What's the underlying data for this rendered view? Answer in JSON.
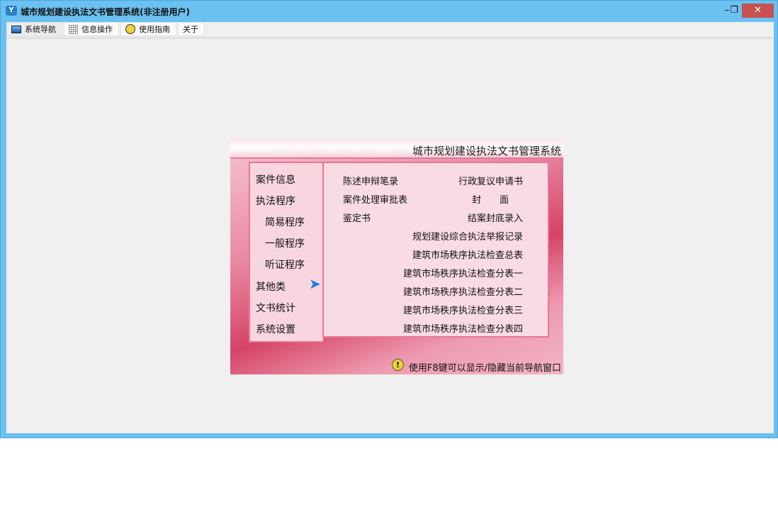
{
  "window": {
    "title": "城市规划建设执法文书管理系统(非注册用户)",
    "minimize": "–",
    "restore": "❐",
    "close": "✕"
  },
  "tabs": [
    {
      "label": "系统导航",
      "icon": "monitor-icon"
    },
    {
      "label": "信息操作",
      "icon": "grid-icon"
    },
    {
      "label": "使用指南",
      "icon": "clock-icon"
    },
    {
      "label": "关于"
    }
  ],
  "panel": {
    "title": "城市规划建设执法文书管理系统",
    "left_menu": [
      "案件信息",
      "执法程序",
      "简易程序",
      "一般程序",
      "听证程序",
      "其他类",
      "文书统计",
      "系统设置"
    ],
    "right_left": [
      "陈述申辩笔录",
      "案件处理审批表",
      "鉴定书"
    ],
    "right_right": [
      "行政复议申请书",
      "封　　面",
      "结案封底录入",
      "规划建设综合执法举报记录",
      "建筑市场秩序执法检查总表",
      "建筑市场秩序执法检查分表一",
      "建筑市场秩序执法检查分表二",
      "建筑市场秩序执法检查分表三",
      "建筑市场秩序执法检查分表四"
    ],
    "hint": "使用F8键可以显示/隐藏当前导航窗口"
  }
}
